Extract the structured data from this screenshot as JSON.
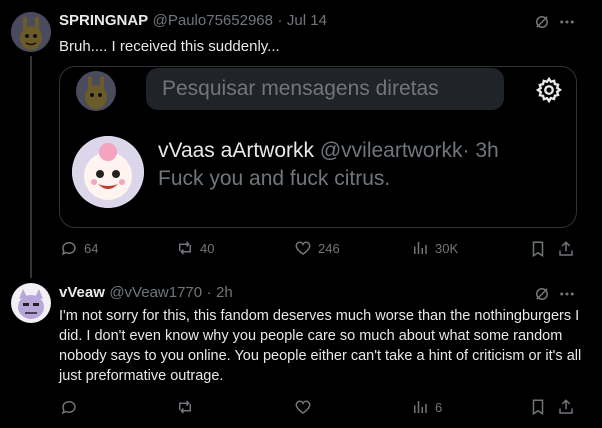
{
  "tweet1": {
    "display_name": "SPRINGNAP",
    "handle": "@Paulo75652968",
    "sep": "·",
    "time": "Jul 14",
    "text": "Bruh.... I received this suddenly...",
    "embed": {
      "search_placeholder": "Pesquisar mensagens diretas",
      "dm_name": "vVaas aArtworkk",
      "dm_handle": "@vvileartworkk",
      "dm_sep": "·",
      "dm_time": "3h",
      "dm_text": "Fuck you and fuck citrus."
    },
    "actions": {
      "replies": "64",
      "reposts": "40",
      "likes": "246",
      "views": "30K"
    }
  },
  "tweet2": {
    "display_name": "vVeaw",
    "handle": "@vVeaw1770",
    "sep": "·",
    "time": "2h",
    "text": "I'm not sorry for this, this fandom deserves much worse than the nothingburgers I did. I don't even know why you people care so much about what some random nobody says to you online. You people either can't take a hint of criticism or it's all just preformative outrage.",
    "actions": {
      "views": "6"
    }
  },
  "colors": {
    "background": "#000000",
    "text": "#e7e9ea",
    "muted": "#71767b",
    "border": "#2f3336",
    "search_bg": "#202327"
  },
  "icons": {
    "more": "more-dots-icon",
    "grok": "grok-icon",
    "reply": "reply-icon",
    "repost": "repost-icon",
    "like": "heart-icon",
    "views": "views-chart-icon",
    "bookmark": "bookmark-icon",
    "share": "share-icon",
    "settings": "gear-icon"
  }
}
